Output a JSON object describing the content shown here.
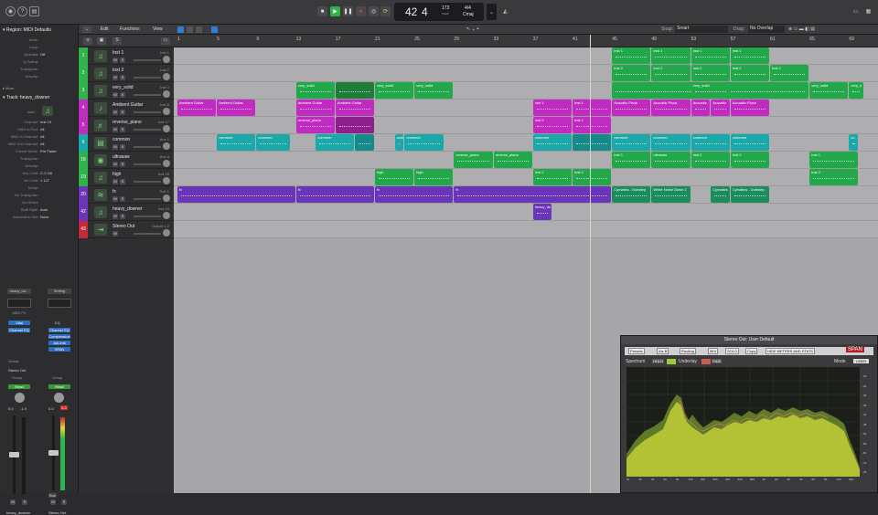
{
  "transport": {
    "position_bars": "42",
    "position_beats": "4",
    "tempo": "173",
    "tempo_label": "KEEP",
    "signature": "4/4",
    "key": "Cmaj"
  },
  "inspector": {
    "region_title": "Region: MIDI Defaults",
    "region_params": [
      {
        "k": "Mute:",
        "v": ""
      },
      {
        "k": "Loop:",
        "v": ""
      },
      {
        "k": "Quantize",
        "v": "Off"
      },
      {
        "k": "Q-Swing:",
        "v": ""
      },
      {
        "k": "Transpose:",
        "v": ""
      },
      {
        "k": "Velocity:",
        "v": ""
      }
    ],
    "more": "More",
    "track_title": "Track: heavy_downer",
    "icon_label": "Icon:",
    "track_params": [
      {
        "k": "Channel:",
        "v": "Inst 19"
      },
      {
        "k": "MIDI In Port:",
        "v": "All"
      },
      {
        "k": "MIDI In Channel:",
        "v": "All"
      },
      {
        "k": "MIDI Out Channel:",
        "v": "All"
      },
      {
        "k": "Freeze Mode:",
        "v": "Pre Fader"
      },
      {
        "k": "Transpose:",
        "v": ""
      },
      {
        "k": "Velocity:",
        "v": ""
      },
      {
        "k": "Key Limit:",
        "v": "C-2  G8"
      },
      {
        "k": "Vel Limit:",
        "v": "1  127"
      },
      {
        "k": "Delay:",
        "v": ""
      },
      {
        "k": "No Transpose:",
        "v": ""
      },
      {
        "k": "No Reset:",
        "v": ""
      },
      {
        "k": "Staff Style:",
        "v": "Auto"
      },
      {
        "k": "Articulation Set:",
        "v": "None"
      }
    ],
    "strip_left": {
      "name": "heavy_do...",
      "midi_fx": "MIDI FX",
      "instrument": "Vital",
      "eq": "Channel EQ",
      "send": "Sends",
      "output": "Stereo Out",
      "group": "Group",
      "auto": "Read",
      "val1": "0.0",
      "val2": "-1.9",
      "m": "M",
      "s": "S",
      "footer": "heavy_downer"
    },
    "strip_right": {
      "name": "Setting",
      "eq_small": "EQ",
      "plugins": [
        "Channel EQ",
        "Compression",
        "AdLimit",
        "SPAN"
      ],
      "group": "Group",
      "auto": "Read",
      "val1": "0.0",
      "val2": "0.0",
      "bnc": "Bnc",
      "m": "M",
      "s": "S",
      "footer": "Stereo Out"
    }
  },
  "editbar": {
    "menus": [
      "Edit",
      "Functions",
      "View"
    ],
    "snap_label": "Snap:",
    "snap_value": "Smart",
    "drag_label": "Drag:",
    "drag_value": "No Overlap"
  },
  "ruler": [
    "1",
    "5",
    "9",
    "13",
    "17",
    "21",
    "25",
    "29",
    "33",
    "37",
    "41",
    "45",
    "49",
    "53",
    "57",
    "61",
    "65",
    "69"
  ],
  "tracks": [
    {
      "num": "1",
      "name": "Inst 1",
      "ch": "Inst 1",
      "color": "#2fb34a",
      "icon": "keyboard-icon"
    },
    {
      "num": "2",
      "name": "Inst 2",
      "ch": "Inst 2",
      "color": "#2fb34a",
      "icon": "keyboard-icon"
    },
    {
      "num": "3",
      "name": "very_solid",
      "ch": "Inst 3",
      "color": "#2fb34a",
      "icon": "keyboard-icon"
    },
    {
      "num": "4",
      "name": "Ambient Guitar",
      "ch": "Inst 8",
      "color": "#c22bc2",
      "icon": "guitar-icon"
    },
    {
      "num": "5",
      "name": "reverse_piano",
      "ch": "Inst 17",
      "color": "#c22bc2",
      "icon": "piano-icon"
    },
    {
      "num": "6",
      "name": "common",
      "ch": "Aux 1",
      "color": "#1aa8a8",
      "icon": "folder-icon"
    },
    {
      "num": "16",
      "name": "ultrasaw",
      "ch": "Aux 4",
      "color": "#2fb34a",
      "icon": "speaker-icon"
    },
    {
      "num": "19",
      "name": "high",
      "ch": "Inst 16",
      "color": "#2fb34a",
      "icon": "keyboard-icon"
    },
    {
      "num": "20",
      "name": "fx",
      "ch": "Sub 1",
      "color": "#6a35b8",
      "icon": "audio-icon"
    },
    {
      "num": "42",
      "name": "heavy_downer",
      "ch": "Inst 19",
      "color": "#6a35b8",
      "icon": "keyboard-icon"
    },
    {
      "num": "43",
      "name": "Stereo Out",
      "ch": "Output 1-2",
      "color": "#c42a3a",
      "icon": "output-icon"
    }
  ],
  "regions": [
    {
      "row": 0,
      "bar": 45,
      "len": 4,
      "label": "Inst 1",
      "color": "#22a84a"
    },
    {
      "row": 0,
      "bar": 49,
      "len": 4,
      "label": "Inst 1",
      "color": "#22a84a"
    },
    {
      "row": 0,
      "bar": 53,
      "len": 4,
      "label": "Inst 1",
      "color": "#22a84a"
    },
    {
      "row": 0,
      "bar": 57,
      "len": 4,
      "label": "Inst 1",
      "color": "#22a84a"
    },
    {
      "row": 1,
      "bar": 45,
      "len": 4,
      "label": "Inst 2",
      "color": "#22a84a"
    },
    {
      "row": 1,
      "bar": 49,
      "len": 4,
      "label": "Inst 2",
      "color": "#22a84a"
    },
    {
      "row": 1,
      "bar": 53,
      "len": 4,
      "label": "Inst 2",
      "color": "#22a84a"
    },
    {
      "row": 1,
      "bar": 57,
      "len": 4,
      "label": "Inst 2",
      "color": "#22a84a"
    },
    {
      "row": 1,
      "bar": 61,
      "len": 4,
      "label": "Inst 2",
      "color": "#22a84a"
    },
    {
      "row": 2,
      "bar": 13,
      "len": 4,
      "label": "very_solid",
      "color": "#22a84a"
    },
    {
      "row": 2,
      "bar": 17,
      "len": 4,
      "label": "",
      "color": "#1d7c3a"
    },
    {
      "row": 2,
      "bar": 21,
      "len": 4,
      "label": "very_solid",
      "color": "#22a84a"
    },
    {
      "row": 2,
      "bar": 25,
      "len": 4,
      "label": "very_solid",
      "color": "#22a84a"
    },
    {
      "row": 2,
      "bar": 45,
      "len": 20,
      "label": "",
      "color": "#22a84a"
    },
    {
      "row": 2,
      "bar": 53,
      "len": 4,
      "label": "very_solid",
      "color": "#22a84a"
    },
    {
      "row": 2,
      "bar": 65,
      "len": 4,
      "label": "very_solid",
      "color": "#22a84a"
    },
    {
      "row": 2,
      "bar": 69,
      "len": 1.5,
      "label": "very_s",
      "color": "#22a84a"
    },
    {
      "row": 3,
      "bar": 1,
      "len": 4,
      "label": "Ambient Guitar",
      "color": "#c22bc2"
    },
    {
      "row": 3,
      "bar": 5,
      "len": 4,
      "label": "Ambient Guitar",
      "color": "#c22bc2"
    },
    {
      "row": 3,
      "bar": 13,
      "len": 4,
      "label": "Ambient Guitar",
      "color": "#c22bc2"
    },
    {
      "row": 3,
      "bar": 17,
      "len": 4,
      "label": "Ambient Guitar",
      "color": "#c22bc2"
    },
    {
      "row": 3,
      "bar": 37,
      "len": 4,
      "label": "Inst 1",
      "color": "#c22bc2"
    },
    {
      "row": 3,
      "bar": 41,
      "len": 4,
      "label": "Inst 1",
      "color": "#c22bc2"
    },
    {
      "row": 3,
      "bar": 45,
      "len": 4,
      "label": "Acoustic Pluck",
      "color": "#c22bc2"
    },
    {
      "row": 3,
      "bar": 49,
      "len": 4,
      "label": "Acoustic Pluck",
      "color": "#c22bc2"
    },
    {
      "row": 3,
      "bar": 53,
      "len": 2,
      "label": "Acoustic",
      "color": "#c22bc2"
    },
    {
      "row": 3,
      "bar": 55,
      "len": 2,
      "label": "Acoustic",
      "color": "#c22bc2"
    },
    {
      "row": 3,
      "bar": 57,
      "len": 4,
      "label": "Acoustic Pluck",
      "color": "#c22bc2"
    },
    {
      "row": 4,
      "bar": 13,
      "len": 4,
      "label": "reverse_piano",
      "color": "#c22bc2"
    },
    {
      "row": 4,
      "bar": 17,
      "len": 4,
      "label": "",
      "color": "#8e1f8e"
    },
    {
      "row": 4,
      "bar": 37,
      "len": 4,
      "label": "Inst 2",
      "color": "#c22bc2"
    },
    {
      "row": 4,
      "bar": 41,
      "len": 4,
      "label": "Inst 2",
      "color": "#c22bc2"
    },
    {
      "row": 5,
      "bar": 5,
      "len": 4,
      "label": "common",
      "color": "#1aa8a8"
    },
    {
      "row": 5,
      "bar": 9,
      "len": 3.5,
      "label": "common",
      "color": "#1aa8a8"
    },
    {
      "row": 5,
      "bar": 15,
      "len": 4,
      "label": "common",
      "color": "#1aa8a8"
    },
    {
      "row": 5,
      "bar": 19,
      "len": 2,
      "label": "",
      "color": "#168a8a"
    },
    {
      "row": 5,
      "bar": 23,
      "len": 1,
      "label": "com",
      "color": "#1aa8a8"
    },
    {
      "row": 5,
      "bar": 24,
      "len": 4,
      "label": "common",
      "color": "#1aa8a8"
    },
    {
      "row": 5,
      "bar": 37,
      "len": 4,
      "label": "common",
      "color": "#1aa8a8"
    },
    {
      "row": 5,
      "bar": 41,
      "len": 4,
      "label": "",
      "color": "#168a8a"
    },
    {
      "row": 5,
      "bar": 45,
      "len": 4,
      "label": "common",
      "color": "#1aa8a8"
    },
    {
      "row": 5,
      "bar": 49,
      "len": 4,
      "label": "common",
      "color": "#1aa8a8"
    },
    {
      "row": 5,
      "bar": 53,
      "len": 4,
      "label": "common",
      "color": "#1aa8a8"
    },
    {
      "row": 5,
      "bar": 57,
      "len": 4,
      "label": "common",
      "color": "#1aa8a8"
    },
    {
      "row": 5,
      "bar": 69,
      "len": 1,
      "label": "co",
      "color": "#1aa8a8"
    },
    {
      "row": 6,
      "bar": 29,
      "len": 4,
      "label": "reverse_piano",
      "color": "#22a84a"
    },
    {
      "row": 6,
      "bar": 33,
      "len": 4,
      "label": "reverse_piano",
      "color": "#22a84a"
    },
    {
      "row": 6,
      "bar": 45,
      "len": 4,
      "label": "Inst 1",
      "color": "#22a84a"
    },
    {
      "row": 6,
      "bar": 49,
      "len": 4,
      "label": "ultrasaw",
      "color": "#22a84a"
    },
    {
      "row": 6,
      "bar": 53,
      "len": 4,
      "label": "Inst 2",
      "color": "#22a84a"
    },
    {
      "row": 6,
      "bar": 57,
      "len": 4,
      "label": "Inst 2",
      "color": "#22a84a"
    },
    {
      "row": 6,
      "bar": 65,
      "len": 5,
      "label": "Inst 1",
      "color": "#22a84a"
    },
    {
      "row": 7,
      "bar": 21,
      "len": 4,
      "label": "high",
      "color": "#22a84a"
    },
    {
      "row": 7,
      "bar": 25,
      "len": 4,
      "label": "high",
      "color": "#22a84a"
    },
    {
      "row": 7,
      "bar": 37,
      "len": 4,
      "label": "Inst 2",
      "color": "#22a84a"
    },
    {
      "row": 7,
      "bar": 41,
      "len": 4,
      "label": "Inst 2",
      "color": "#22a84a"
    },
    {
      "row": 7,
      "bar": 65,
      "len": 5,
      "label": "Inst 2",
      "color": "#22a84a"
    },
    {
      "row": 8,
      "bar": 1,
      "len": 12,
      "label": "fx",
      "color": "#6a35b8"
    },
    {
      "row": 8,
      "bar": 13,
      "len": 8,
      "label": "fx",
      "color": "#6a35b8"
    },
    {
      "row": 8,
      "bar": 21,
      "len": 8,
      "label": "fx",
      "color": "#6a35b8"
    },
    {
      "row": 8,
      "bar": 29,
      "len": 16,
      "label": "fx",
      "color": "#6a35b8"
    },
    {
      "row": 8,
      "bar": 45,
      "len": 4,
      "label": "Cymatics - Dubstep",
      "color": "#1d8c5c"
    },
    {
      "row": 8,
      "bar": 49,
      "len": 4,
      "label": "White Noise Down 1",
      "color": "#1d8c5c"
    },
    {
      "row": 8,
      "bar": 55,
      "len": 2,
      "label": "Cymatics",
      "color": "#1d8c5c"
    },
    {
      "row": 8,
      "bar": 57,
      "len": 4,
      "label": "Cymatics - Dubstep",
      "color": "#1d8c5c"
    },
    {
      "row": 9,
      "bar": 37,
      "len": 2,
      "label": "heavy_do",
      "color": "#6a35b8"
    }
  ],
  "span": {
    "title": "Stereo Out: User Default",
    "toolbar": [
      "Presets",
      "A ▸ B",
      "Routing",
      "MIX",
      "SOLO",
      "Copy",
      "HIDE METERS AND STATS"
    ],
    "brand": "SPAN",
    "spectrum_label": "Spectrum",
    "hold": "HOLD",
    "underlay": "Underlay",
    "side": "SIDE",
    "mode_label": "Mode",
    "mode_value": "USER",
    "freq_ticks": [
      "20",
      "30",
      "40",
      "60",
      "80",
      "100",
      "200",
      "300",
      "400",
      "600",
      "800",
      "1K",
      "2K",
      "3K",
      "4K",
      "6K",
      "8K",
      "10K",
      "20K"
    ],
    "db_ticks": [
      "-18",
      "-24",
      "-30",
      "-36",
      "-42",
      "-48",
      "-54",
      "-60",
      "-66",
      "-72",
      "-78"
    ]
  },
  "colors": {
    "accent": "#2d7fd3",
    "green": "#2fb34a",
    "magenta": "#c22bc2",
    "teal": "#1aa8a8",
    "purple": "#6a35b8"
  }
}
